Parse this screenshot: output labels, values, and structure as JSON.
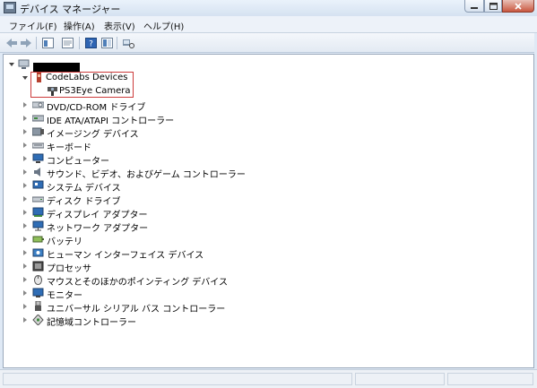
{
  "window": {
    "title": "デバイス マネージャー"
  },
  "menu": [
    {
      "label": "ファイル(F)"
    },
    {
      "label": "操作(A)"
    },
    {
      "label": "表示(V)"
    },
    {
      "label": "ヘルプ(H)"
    }
  ],
  "toolbar": {
    "buttons": [
      "back-icon",
      "forward-icon",
      "console-tree-icon",
      "properties-icon",
      "help-icon",
      "show-hide-icon",
      "scan-hardware-icon"
    ]
  },
  "tree": {
    "root": {
      "label": ""
    },
    "highlighted_group": {
      "label": "CodeLabs Devices",
      "child": "PS3Eye Camera"
    },
    "categories": [
      {
        "label": "DVD/CD-ROM ドライブ",
        "icon": "optical-drive-icon"
      },
      {
        "label": "IDE ATA/ATAPI コントローラー",
        "icon": "ide-controller-icon"
      },
      {
        "label": "イメージング デバイス",
        "icon": "imaging-device-icon"
      },
      {
        "label": "キーボード",
        "icon": "keyboard-icon"
      },
      {
        "label": "コンピューター",
        "icon": "computer-icon"
      },
      {
        "label": "サウンド、ビデオ、およびゲーム コントローラー",
        "icon": "sound-icon"
      },
      {
        "label": "システム デバイス",
        "icon": "system-device-icon"
      },
      {
        "label": "ディスク ドライブ",
        "icon": "disk-drive-icon"
      },
      {
        "label": "ディスプレイ アダプター",
        "icon": "display-adapter-icon"
      },
      {
        "label": "ネットワーク アダプター",
        "icon": "network-adapter-icon"
      },
      {
        "label": "バッテリ",
        "icon": "battery-icon"
      },
      {
        "label": "ヒューマン インターフェイス デバイス",
        "icon": "hid-icon"
      },
      {
        "label": "プロセッサ",
        "icon": "processor-icon"
      },
      {
        "label": "マウスとそのほかのポインティング デバイス",
        "icon": "mouse-icon"
      },
      {
        "label": "モニター",
        "icon": "monitor-icon"
      },
      {
        "label": "ユニバーサル シリアル バス コントローラー",
        "icon": "usb-icon"
      },
      {
        "label": "記憶域コントローラー",
        "icon": "storage-controller-icon"
      }
    ]
  }
}
